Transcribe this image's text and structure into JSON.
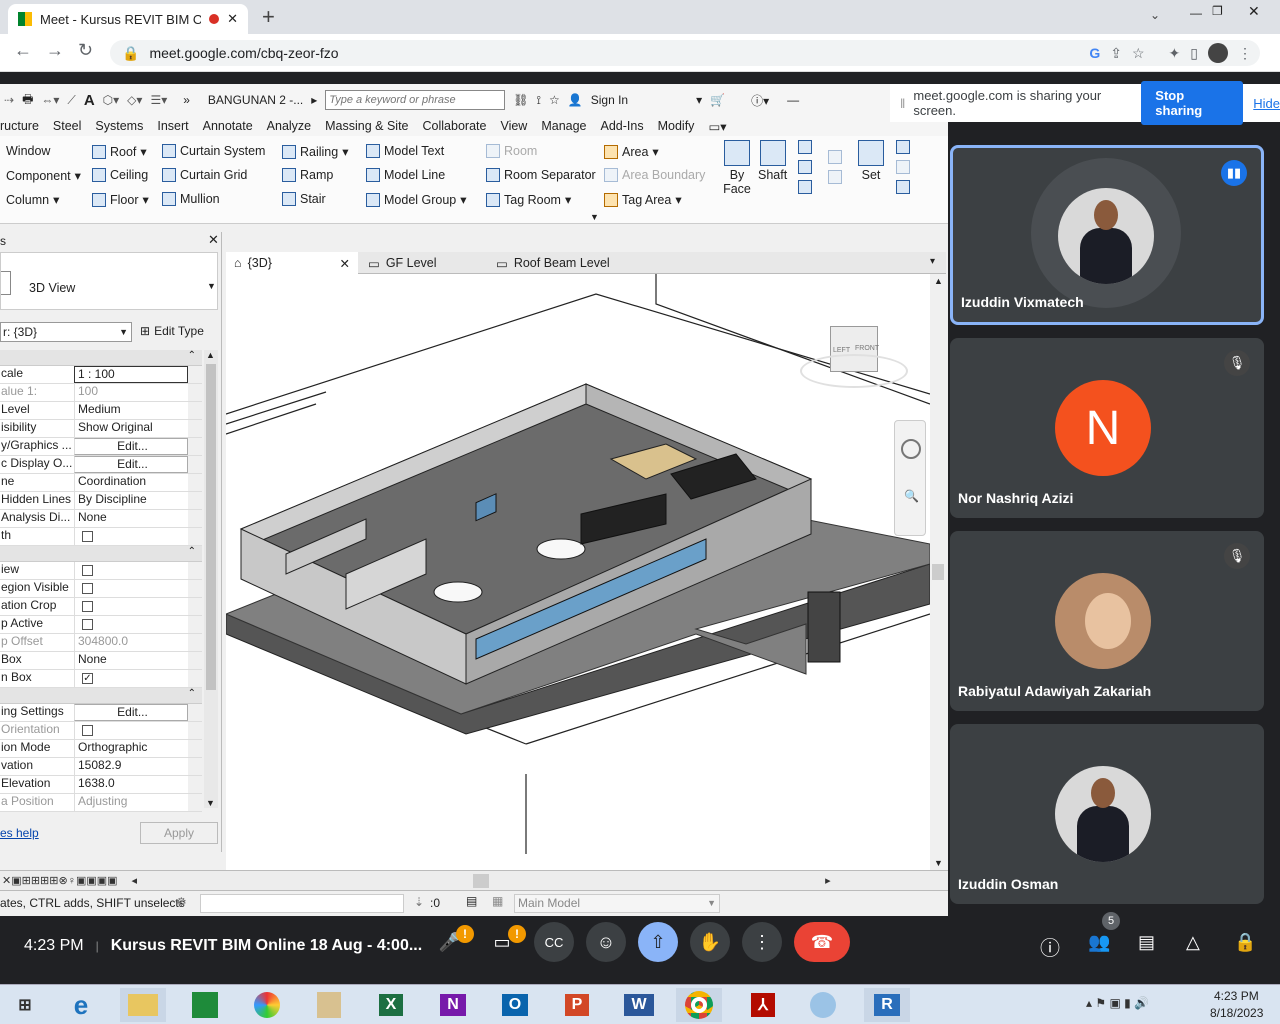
{
  "browser": {
    "tab_title": "Meet - Kursus REVIT BIM On",
    "new_tab": "+",
    "url": "meet.google.com/cbq-zeor-fzo",
    "window_controls": [
      "—",
      "❐",
      "✕"
    ]
  },
  "revit": {
    "project_title": "BANGUNAN 2 -...",
    "search_placeholder": "Type a keyword or phrase",
    "sign_in": "Sign In",
    "menu_tabs": [
      "ructure",
      "Steel",
      "Systems",
      "Insert",
      "Annotate",
      "Analyze",
      "Massing & Site",
      "Collaborate",
      "View",
      "Manage",
      "Add-Ins",
      "Modify"
    ],
    "ribbon": {
      "col1": [
        "Window",
        "Component",
        "Column"
      ],
      "col2": [
        "Roof",
        "Ceiling",
        "Floor"
      ],
      "col3": [
        "Curtain System",
        "Curtain Grid",
        "Mullion"
      ],
      "col4": [
        "Railing",
        "Ramp",
        "Stair"
      ],
      "col5": [
        "Model Text",
        "Model Line",
        "Model Group"
      ],
      "col6": [
        "Room",
        "Room Separator",
        "Tag Room"
      ],
      "col7": [
        "Area",
        "Area Boundary",
        "Tag Area"
      ],
      "by_face": "By Face",
      "shaft": "Shaft",
      "set": "Set"
    },
    "properties": {
      "type_name": "3D View",
      "selector": "r: {3D}",
      "edit_type": "Edit Type",
      "rows": [
        {
          "k": "cale",
          "v": "1 : 100"
        },
        {
          "k": "alue    1:",
          "v": "100",
          "dim": true
        },
        {
          "k": "Level",
          "v": "Medium"
        },
        {
          "k": "isibility",
          "v": "Show Original"
        },
        {
          "k": "y/Graphics ...",
          "v": "Edit...",
          "btn": true
        },
        {
          "k": "c Display O...",
          "v": "Edit...",
          "btn": true
        },
        {
          "k": "ne",
          "v": "Coordination"
        },
        {
          "k": "Hidden Lines",
          "v": "By Discipline"
        },
        {
          "k": "Analysis Di...",
          "v": "None"
        },
        {
          "k": "th",
          "v": "",
          "chk": false
        }
      ],
      "rows2": [
        {
          "k": "iew",
          "v": "",
          "chk": false
        },
        {
          "k": "egion Visible",
          "v": "",
          "chk": false
        },
        {
          "k": "ation Crop",
          "v": "",
          "chk": false
        },
        {
          "k": "p Active",
          "v": "",
          "chk": false
        },
        {
          "k": "p Offset",
          "v": "304800.0",
          "dim": true
        },
        {
          "k": "Box",
          "v": "None"
        },
        {
          "k": "n Box",
          "v": "",
          "chk": true
        }
      ],
      "rows3": [
        {
          "k": "ing Settings",
          "v": "Edit...",
          "btn": true
        },
        {
          "k": "Orientation",
          "v": "",
          "chk": false,
          "dim": true
        },
        {
          "k": "ion Mode",
          "v": "Orthographic"
        },
        {
          "k": "vation",
          "v": "15082.9"
        },
        {
          "k": "Elevation",
          "v": "1638.0"
        },
        {
          "k": "a Position",
          "v": "Adjusting",
          "dim": true
        }
      ],
      "help": "es help",
      "apply": "Apply"
    },
    "view_tabs": [
      "{3D}",
      "GF Level",
      "Roof Beam Level"
    ],
    "viewcube": {
      "left": "LEFT",
      "front": "FRONT"
    },
    "status": "ates, CTRL adds, SHIFT unselects",
    "filter_count": ":0",
    "model": "Main Model"
  },
  "meet": {
    "sharing_text": "meet.google.com is sharing your screen.",
    "stop_sharing": "Stop sharing",
    "hide": "Hide",
    "participants": [
      {
        "name": "Izuddin Vixmatech",
        "speaking": true
      },
      {
        "name": "Nor Nashriq Azizi",
        "initial": "N",
        "muted": true
      },
      {
        "name": "Rabiyatul Adawiyah Zakariah",
        "muted": true
      },
      {
        "name": "Izuddin Osman"
      }
    ],
    "time": "4:23 PM",
    "separator": "|",
    "meeting_title": "Kursus REVIT BIM Online 18 Aug - 4:00...",
    "participant_count": "5",
    "warning": "!"
  },
  "taskbar": {
    "apps": [
      "start",
      "ie",
      "explorer",
      "excel-green",
      "chrome-pic",
      "cert",
      "X",
      "N",
      "O",
      "P",
      "W",
      "chrome",
      "acrobat",
      "paint",
      "R"
    ],
    "clock_time": "4:23 PM",
    "clock_date": "8/18/2023"
  },
  "colors": {
    "meet_bg": "#202124",
    "tile_bg": "#3c4043",
    "accent": "#1a73e8",
    "end_call": "#ea4335",
    "orange_avatar": "#f4511e"
  }
}
